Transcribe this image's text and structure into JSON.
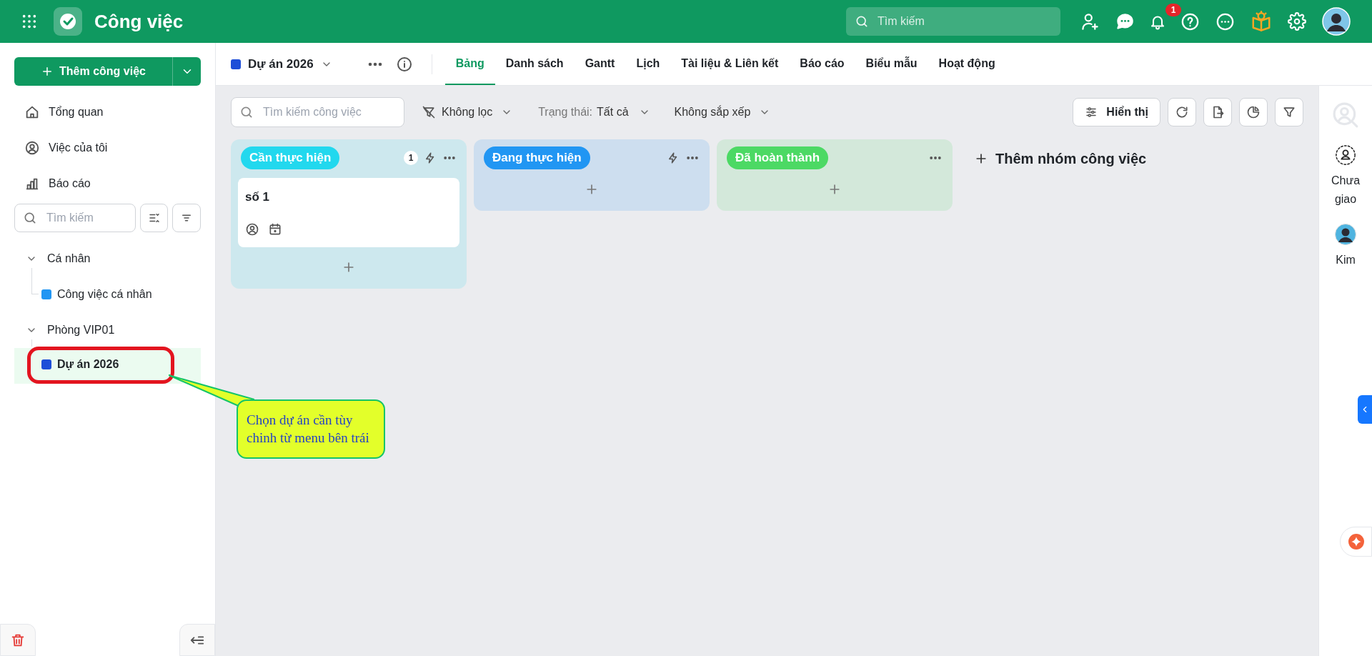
{
  "app": {
    "title": "Công việc"
  },
  "header": {
    "search": {
      "placeholder": "Tìm kiếm"
    },
    "notification_count": "1"
  },
  "sidebar": {
    "add_button": "Thêm công việc",
    "nav": [
      {
        "kind": "home",
        "label": "Tổng quan"
      },
      {
        "kind": "user",
        "label": "Việc của tôi"
      },
      {
        "kind": "chart",
        "label": "Báo cáo"
      }
    ],
    "search": {
      "placeholder": "Tìm kiếm"
    },
    "tree": [
      {
        "label": "Cá nhân",
        "expanded": true,
        "children": [
          {
            "label": "Công việc cá nhân",
            "color": "#2196f3",
            "selected": false
          }
        ]
      },
      {
        "label": "Phòng VIP01",
        "expanded": true,
        "children": [
          {
            "label": "Dự án 2026",
            "color": "#1d4ed8",
            "selected": true
          }
        ]
      }
    ]
  },
  "project": {
    "name": "Dự án 2026",
    "color": "#1d4ed8"
  },
  "tabs": [
    {
      "label": "Bảng",
      "selected": true
    },
    {
      "label": "Danh sách",
      "selected": false
    },
    {
      "label": "Gantt",
      "selected": false
    },
    {
      "label": "Lịch",
      "selected": false
    },
    {
      "label": "Tài liệu & Liên kết",
      "selected": false
    },
    {
      "label": "Báo cáo",
      "selected": false
    },
    {
      "label": "Biểu mẫu",
      "selected": false
    },
    {
      "label": "Hoạt động",
      "selected": false
    }
  ],
  "toolbar": {
    "search": {
      "placeholder": "Tìm kiếm công việc"
    },
    "filter": "Không lọc",
    "status_label": "Trạng thái:",
    "status_value": "Tất cả",
    "sort": "Không sắp xếp",
    "display_button": "Hiển thị"
  },
  "columns": [
    {
      "title": "Cần thực hiện",
      "color": "#22d8ee",
      "count": "1",
      "automation": true,
      "cards": [
        {
          "title": "số 1"
        }
      ]
    },
    {
      "title": "Đang thực hiện",
      "color": "#2196f3",
      "automation": true
    },
    {
      "title": "Đã hoàn thành",
      "color": "#4cd964",
      "automation": false
    }
  ],
  "add_group": "Thêm nhóm công việc",
  "assignees": [
    {
      "kind": "unassigned",
      "label": "Chưa giao"
    },
    {
      "kind": "user",
      "label": "Kim"
    }
  ],
  "callout": {
    "text": "Chọn dự án cần tùy chinh từ menu bên trái"
  }
}
